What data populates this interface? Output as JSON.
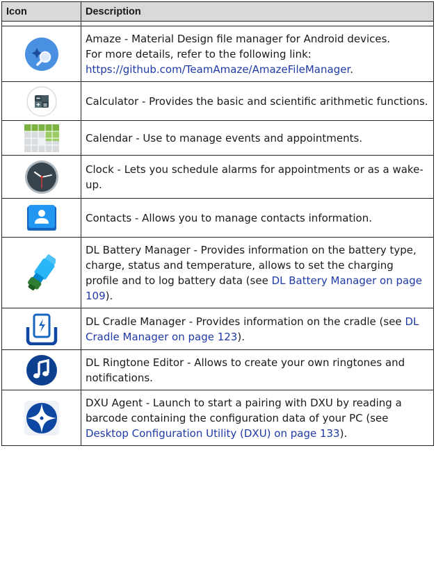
{
  "header": {
    "icon": "Icon",
    "description": "Description"
  },
  "rows": [
    {
      "icon": "amaze-icon",
      "lines": [
        "Amaze - Material Design file manager for Android devices.",
        "For more details, refer to the following link:"
      ],
      "link": "https://github.com/TeamAmaze/AmazeFileManager",
      "after": "."
    },
    {
      "icon": "calculator-icon",
      "text": "Calculator - Provides the basic and scientific arithmetic functions."
    },
    {
      "icon": "calendar-icon",
      "text": "Calendar - Use to manage events and appointments."
    },
    {
      "icon": "clock-icon",
      "text": "Clock - Lets you schedule alarms for appointments or as a wake-up."
    },
    {
      "icon": "contacts-icon",
      "text": "Contacts - Allows you to manage contacts information."
    },
    {
      "icon": "battery-manager-icon",
      "text": "DL Battery Manager - Provides information on the battery type, charge, status and temperature, allows to set the charging profile and to log battery data (see ",
      "link": "DL Battery Manager on page 109",
      "after": ")."
    },
    {
      "icon": "cradle-manager-icon",
      "text": "DL Cradle Manager - Provides information on the cradle (see ",
      "link": "DL Cradle Manager on page 123",
      "after": ")."
    },
    {
      "icon": "ringtone-editor-icon",
      "text": "DL Ringtone Editor - Allows to create your own ringtones and notifications."
    },
    {
      "icon": "dxu-agent-icon",
      "text": "DXU Agent - Launch to start a pairing with DXU by reading a barcode containing the configuration data of your PC (see ",
      "link": "Desktop Configuration Utility (DXU) on page 133",
      "after": ")."
    }
  ]
}
